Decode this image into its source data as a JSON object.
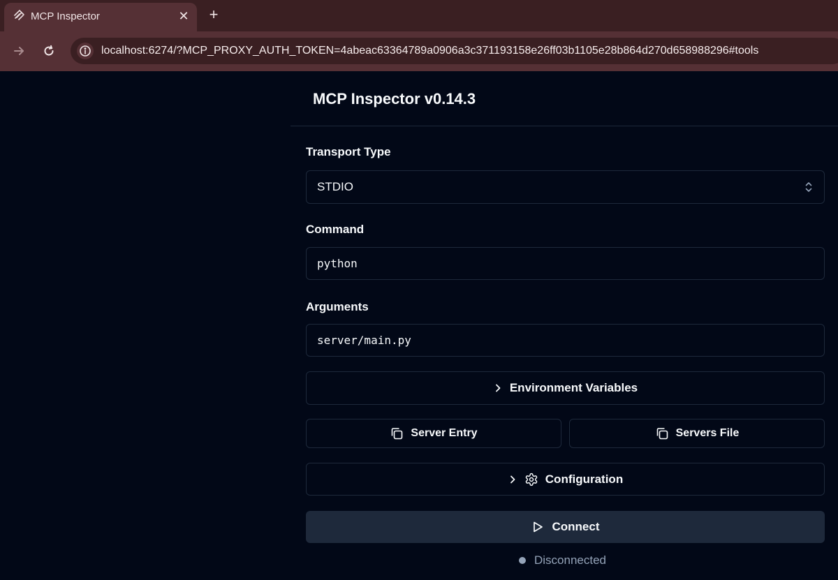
{
  "browser": {
    "tab_title": "MCP Inspector",
    "url": "localhost:6274/?MCP_PROXY_AUTH_TOKEN=4abeac63364789a0906a3c371193158e26ff03b1105e28b864d270d658988296#tools",
    "icons": {
      "favicon": "mcp-logo-icon",
      "close": "close-icon",
      "new_tab": "plus-icon",
      "forward": "arrow-right-icon",
      "reload": "reload-icon",
      "site_info": "info-icon"
    }
  },
  "app": {
    "title": "MCP Inspector v0.14.3",
    "transport": {
      "label": "Transport Type",
      "value": "STDIO"
    },
    "command": {
      "label": "Command",
      "value": "python"
    },
    "arguments": {
      "label": "Arguments",
      "value": "server/main.py"
    },
    "env_vars_label": "Environment Variables",
    "server_entry_label": "Server Entry",
    "servers_file_label": "Servers File",
    "configuration_label": "Configuration",
    "connect_label": "Connect",
    "status_text": "Disconnected"
  },
  "colors": {
    "background": "#020817",
    "border": "#1e293b",
    "connect_bg": "#1e293b",
    "status_dot": "#94a3b8",
    "browser_frame": "#553035"
  }
}
